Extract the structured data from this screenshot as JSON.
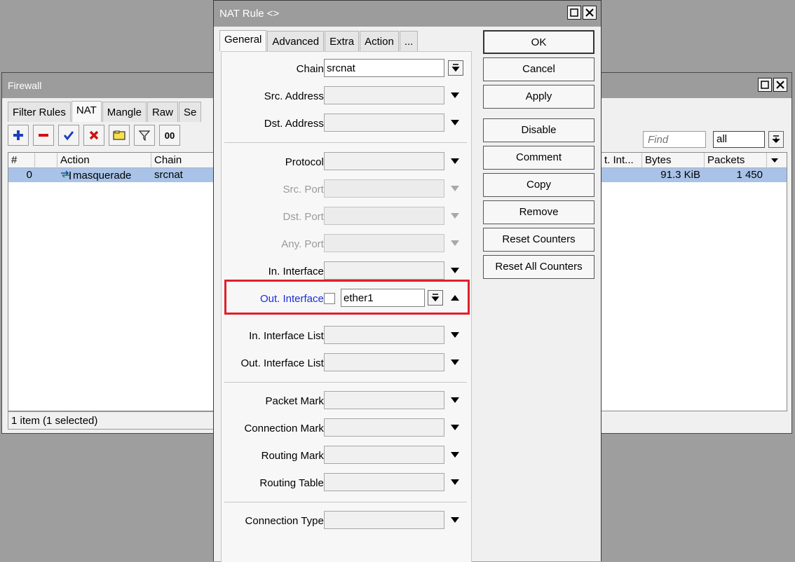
{
  "firewall": {
    "title": "Firewall",
    "tabs": [
      "Filter Rules",
      "NAT",
      "Mangle",
      "Raw",
      "Se"
    ],
    "active_tab": "NAT",
    "toolbar": [
      "add-icon",
      "remove-icon",
      "enable-icon",
      "disable-icon",
      "comment-icon",
      "filter-icon",
      "00"
    ],
    "find_placeholder": "Find",
    "filter_value": "all",
    "columns": [
      "#",
      "Action",
      "Chain",
      "t. Int...",
      "Bytes",
      "Packets"
    ],
    "rows": [
      {
        "num": "0",
        "action": "masquerade",
        "chain": "srcnat",
        "bytes": "91.3 KiB",
        "packets": "1 450"
      }
    ],
    "status": "1 item (1 selected)"
  },
  "nat_rule": {
    "title": "NAT Rule <>",
    "tabs": [
      "General",
      "Advanced",
      "Extra",
      "Action",
      "..."
    ],
    "active_tab": "General",
    "fields": {
      "chain": {
        "label": "Chain:",
        "value": "srcnat"
      },
      "src_address": {
        "label": "Src. Address:"
      },
      "dst_address": {
        "label": "Dst. Address:"
      },
      "protocol": {
        "label": "Protocol:"
      },
      "src_port": {
        "label": "Src. Port:"
      },
      "dst_port": {
        "label": "Dst. Port:"
      },
      "any_port": {
        "label": "Any. Port:"
      },
      "in_interface": {
        "label": "In. Interface:"
      },
      "out_interface": {
        "label": "Out. Interface:",
        "value": "ether1"
      },
      "in_interface_list": {
        "label": "In. Interface List:"
      },
      "out_interface_list": {
        "label": "Out. Interface List:"
      },
      "packet_mark": {
        "label": "Packet Mark:"
      },
      "connection_mark": {
        "label": "Connection Mark:"
      },
      "routing_mark": {
        "label": "Routing Mark:"
      },
      "routing_table": {
        "label": "Routing Table:"
      },
      "connection_type": {
        "label": "Connection Type:"
      }
    },
    "buttons": {
      "ok": "OK",
      "cancel": "Cancel",
      "apply": "Apply",
      "disable": "Disable",
      "comment": "Comment",
      "copy": "Copy",
      "remove": "Remove",
      "reset_counters": "Reset Counters",
      "reset_all_counters": "Reset All Counters"
    }
  },
  "colors": {
    "selection": "#a9c3e8",
    "highlight": "#e0202a",
    "out_interface_label": "#1b2fd6",
    "titlebar": "#9c9c9c"
  }
}
